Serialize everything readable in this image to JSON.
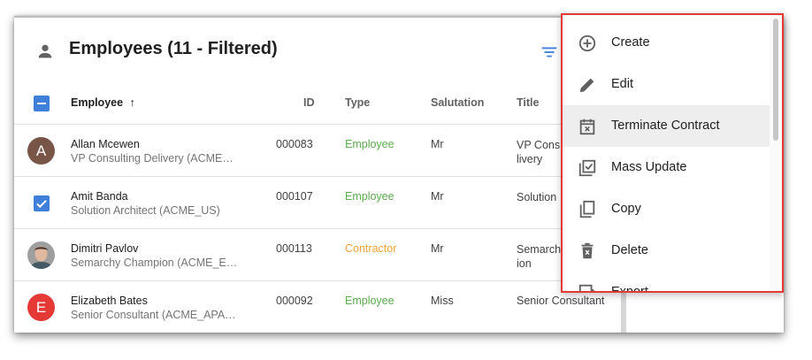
{
  "header": {
    "title": "Employees (11 - Filtered)"
  },
  "columns": {
    "employee": "Employee",
    "sort_arrow": "↑",
    "id": "ID",
    "type": "Type",
    "salutation": "Salutation",
    "title": "Title"
  },
  "rows": [
    {
      "avatar_letter": "A",
      "avatar_color": "#795548",
      "name": "Allan Mcewen",
      "sub": "VP Consulting Delivery (ACME…",
      "id": "000083",
      "type": "Employee",
      "salutation": "Mr",
      "title": "VP Cons\nlivery"
    },
    {
      "avatar_letter": "",
      "name": "Amit Banda",
      "sub": "Solution Architect (ACME_US)",
      "id": "000107",
      "type": "Employee",
      "salutation": "Mr",
      "title": "Solution"
    },
    {
      "avatar_letter": "",
      "name": "Dimitri Pavlov",
      "sub": "Semarchy Champion (ACME_E…",
      "id": "000113",
      "type": "Contractor",
      "salutation": "Mr",
      "title": "Semarch\nion"
    },
    {
      "avatar_letter": "E",
      "avatar_color": "#e53935",
      "name": "Elizabeth Bates",
      "sub": "Senior Consultant (ACME_APA…",
      "id": "000092",
      "type": "Employee",
      "salutation": "Miss",
      "title": "Senior Consultant"
    }
  ],
  "menu": {
    "items": [
      {
        "label": "Create",
        "icon": "add-circle-icon"
      },
      {
        "label": "Edit",
        "icon": "pencil-icon"
      },
      {
        "label": "Terminate Contract",
        "icon": "calendar-x-icon"
      },
      {
        "label": "Mass Update",
        "icon": "library-check-icon"
      },
      {
        "label": "Copy",
        "icon": "copy-icon"
      },
      {
        "label": "Delete",
        "icon": "trash-icon"
      },
      {
        "label": "Export",
        "icon": "export-icon"
      }
    ]
  },
  "colors": {
    "accent": "#3d7fd9",
    "employee": "#5cab4f",
    "contractor": "#f2a33a",
    "highlight_border": "#e53935"
  }
}
